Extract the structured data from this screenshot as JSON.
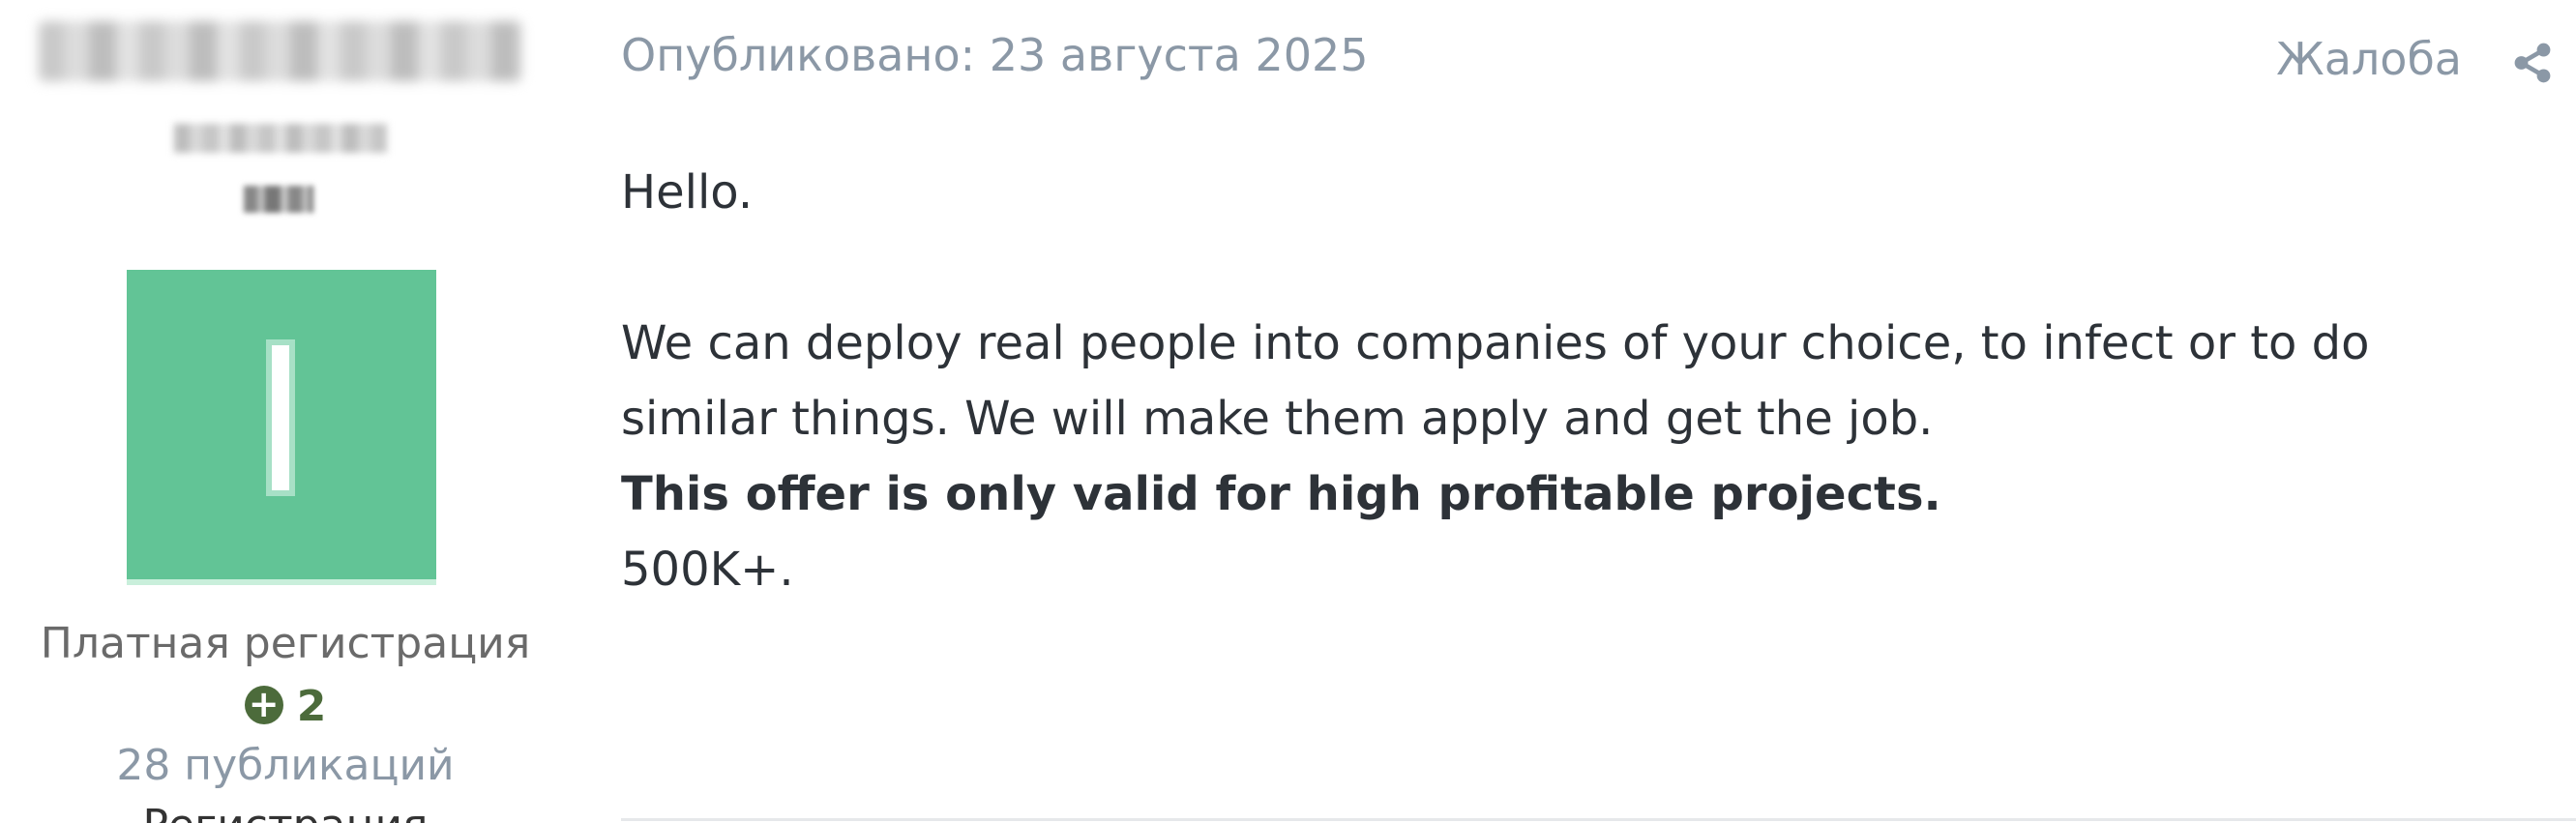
{
  "author": {
    "group": "Платная регистрация",
    "reputation": "2",
    "posts": "28 публикаций",
    "joined": "Регистрация"
  },
  "post": {
    "published": "Опубликовано: 23 августа 2025",
    "report_label": "Жалоба",
    "lines": {
      "greeting": "Hello.",
      "line1": "We can deploy real people into companies of your choice, to infect or to do",
      "line2": "similar things. We will make them apply and get the job.",
      "bold": "This offer is only valid for high profitable projects.",
      "price": "500K+."
    }
  },
  "icons": {
    "share": "share-icon",
    "reputation": "plus-circle-icon"
  },
  "colors": {
    "avatar_bg": "#62c496",
    "reputation": "#4c6b3b",
    "muted": "#8b98a6",
    "text": "#2d3238"
  }
}
